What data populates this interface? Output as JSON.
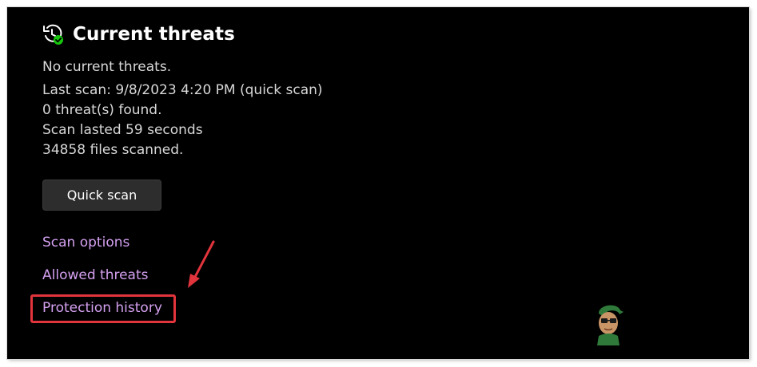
{
  "header": {
    "title": "Current threats",
    "icon": "history-clock-check-icon"
  },
  "status": {
    "summary": "No current threats.",
    "last_scan": "Last scan: 9/8/2023 4:20 PM (quick scan)",
    "threats_found": "0 threat(s) found.",
    "duration": "Scan lasted 59 seconds",
    "files_scanned": "34858 files scanned."
  },
  "actions": {
    "quick_scan_label": "Quick scan"
  },
  "links": {
    "scan_options": "Scan options",
    "allowed_threats": "Allowed threats",
    "protection_history": "Protection history"
  },
  "annotation": {
    "highlight_color": "#e2343c",
    "arrow_color": "#e2343c",
    "target": "protection-history-link"
  },
  "colors": {
    "background": "#000000",
    "link": "#d4a0f0",
    "button_bg": "#2d2d2d",
    "check_badge": "#16c60c"
  }
}
